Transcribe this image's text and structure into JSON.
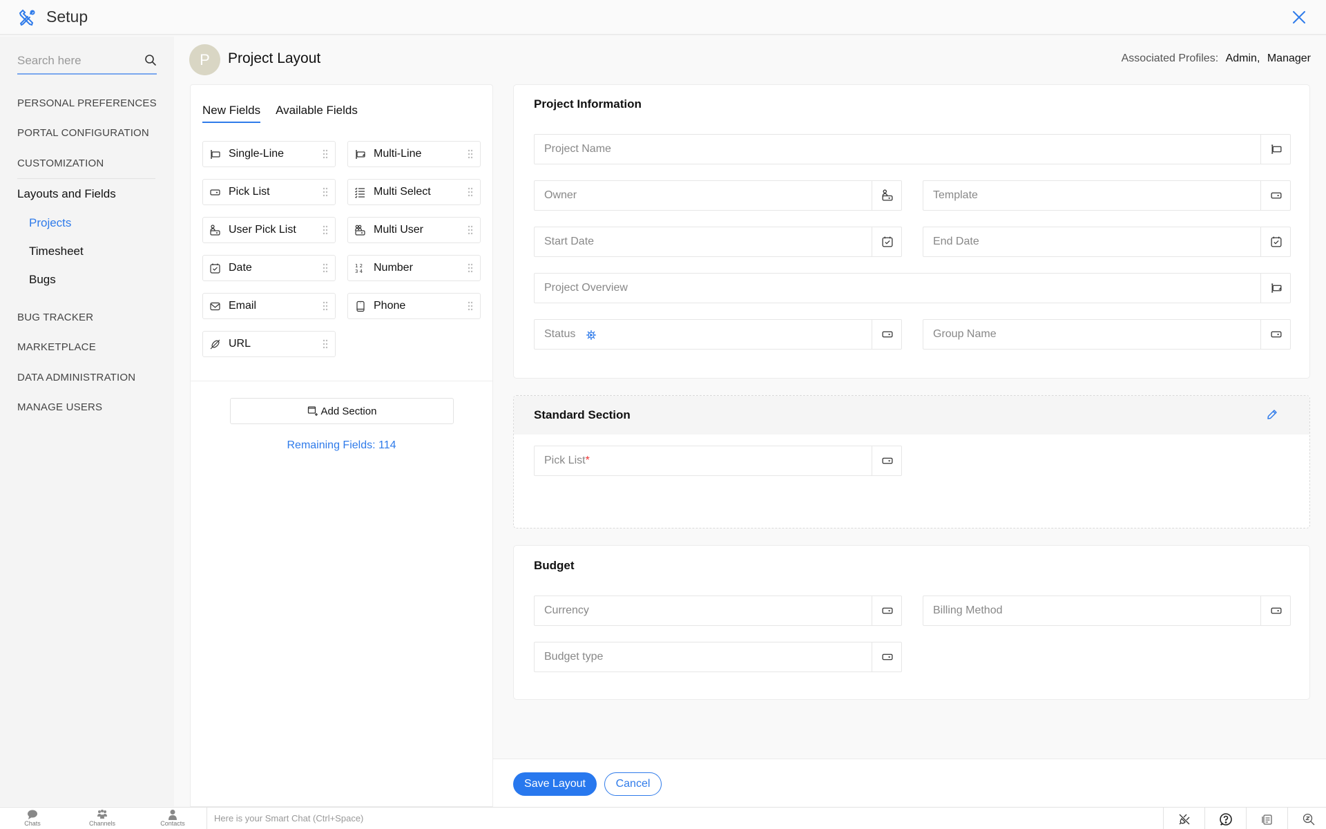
{
  "header": {
    "title": "Setup",
    "logo_icon": "tools-icon",
    "close_icon": "close-icon"
  },
  "sidebar": {
    "search_placeholder": "Search here",
    "top_items": [
      {
        "label": "PERSONAL PREFERENCES"
      },
      {
        "label": "PORTAL CONFIGURATION"
      },
      {
        "label": "CUSTOMIZATION"
      }
    ],
    "group": {
      "label": "Layouts and Fields",
      "items": [
        {
          "label": "Projects",
          "active": true
        },
        {
          "label": "Timesheet",
          "active": false
        },
        {
          "label": "Bugs",
          "active": false
        }
      ]
    },
    "bottom_items": [
      {
        "label": "BUG TRACKER"
      },
      {
        "label": "MARKETPLACE"
      },
      {
        "label": "DATA ADMINISTRATION"
      },
      {
        "label": "MANAGE USERS"
      }
    ]
  },
  "page": {
    "avatar_letter": "P",
    "title": "Project Layout",
    "profiles_label": "Associated Profiles:",
    "profiles": [
      "Admin,",
      "Manager"
    ]
  },
  "fields_panel": {
    "tabs": [
      {
        "label": "New Fields",
        "active": true
      },
      {
        "label": "Available Fields",
        "active": false
      }
    ],
    "field_types": [
      {
        "label": "Single-Line",
        "icon": "single-line-icon"
      },
      {
        "label": "Multi-Line",
        "icon": "multi-line-icon"
      },
      {
        "label": "Pick List",
        "icon": "pick-list-icon"
      },
      {
        "label": "Multi Select",
        "icon": "multi-select-icon"
      },
      {
        "label": "User Pick List",
        "icon": "user-pick-list-icon"
      },
      {
        "label": "Multi User",
        "icon": "multi-user-icon"
      },
      {
        "label": "Date",
        "icon": "date-icon"
      },
      {
        "label": "Number",
        "icon": "number-icon"
      },
      {
        "label": "Email",
        "icon": "email-icon"
      },
      {
        "label": "Phone",
        "icon": "phone-icon"
      },
      {
        "label": "URL",
        "icon": "url-icon"
      }
    ],
    "add_section_label": "Add Section",
    "remaining_fields": "Remaining Fields: 114"
  },
  "sections": {
    "project_info": {
      "title": "Project Information",
      "fields": {
        "project_name": "Project Name",
        "owner": "Owner",
        "template": "Template",
        "start_date": "Start Date",
        "end_date": "End Date",
        "project_overview": "Project Overview",
        "status": "Status",
        "group_name": "Group Name"
      }
    },
    "standard": {
      "title": "Standard Section",
      "fields": {
        "pick_list": "Pick List",
        "pick_list_required": "*"
      }
    },
    "budget": {
      "title": "Budget",
      "fields": {
        "currency": "Currency",
        "billing_method": "Billing Method",
        "budget_type": "Budget type"
      }
    }
  },
  "actions": {
    "save_label": "Save Layout",
    "cancel_label": "Cancel"
  },
  "chatbar": {
    "items": [
      {
        "label": "Chats"
      },
      {
        "label": "Channels"
      },
      {
        "label": "Contacts"
      }
    ],
    "smart_chat_placeholder": "Here is your Smart Chat (Ctrl+Space)"
  },
  "colors": {
    "accent": "#2878ee",
    "link": "#2f7bea",
    "required": "#e33333",
    "avatar_bg": "#d9d6c4"
  }
}
